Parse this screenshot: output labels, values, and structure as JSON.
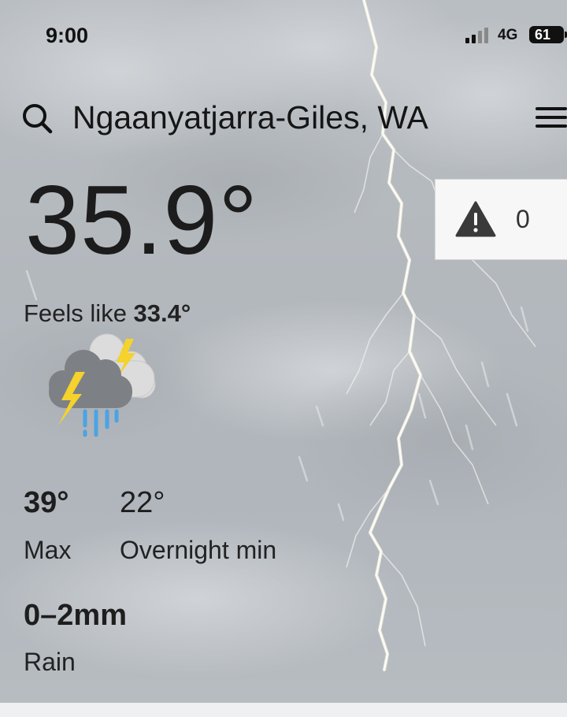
{
  "status_bar": {
    "time": "9:00",
    "network": "4G",
    "battery": "61"
  },
  "header": {
    "location": "Ngaanyatjarra-Giles, WA"
  },
  "current": {
    "temperature": "35.9°",
    "feels_like_label": "Feels like ",
    "feels_like_value": "33.4°",
    "condition_icon": "thunderstorm-rain-icon"
  },
  "warnings": {
    "count": "0",
    "icon": "warning-triangle-icon"
  },
  "forecast": {
    "max_value": "39°",
    "max_label": "Max",
    "min_value": "22°",
    "min_label": "Overnight min",
    "rain_value": "0–2mm",
    "rain_label": "Rain"
  },
  "colors": {
    "lightning_yellow": "#f5d22c",
    "rain_blue": "#4aa3e6",
    "cloud_dark": "#7b7f84",
    "cloud_light": "#d9dadb"
  }
}
